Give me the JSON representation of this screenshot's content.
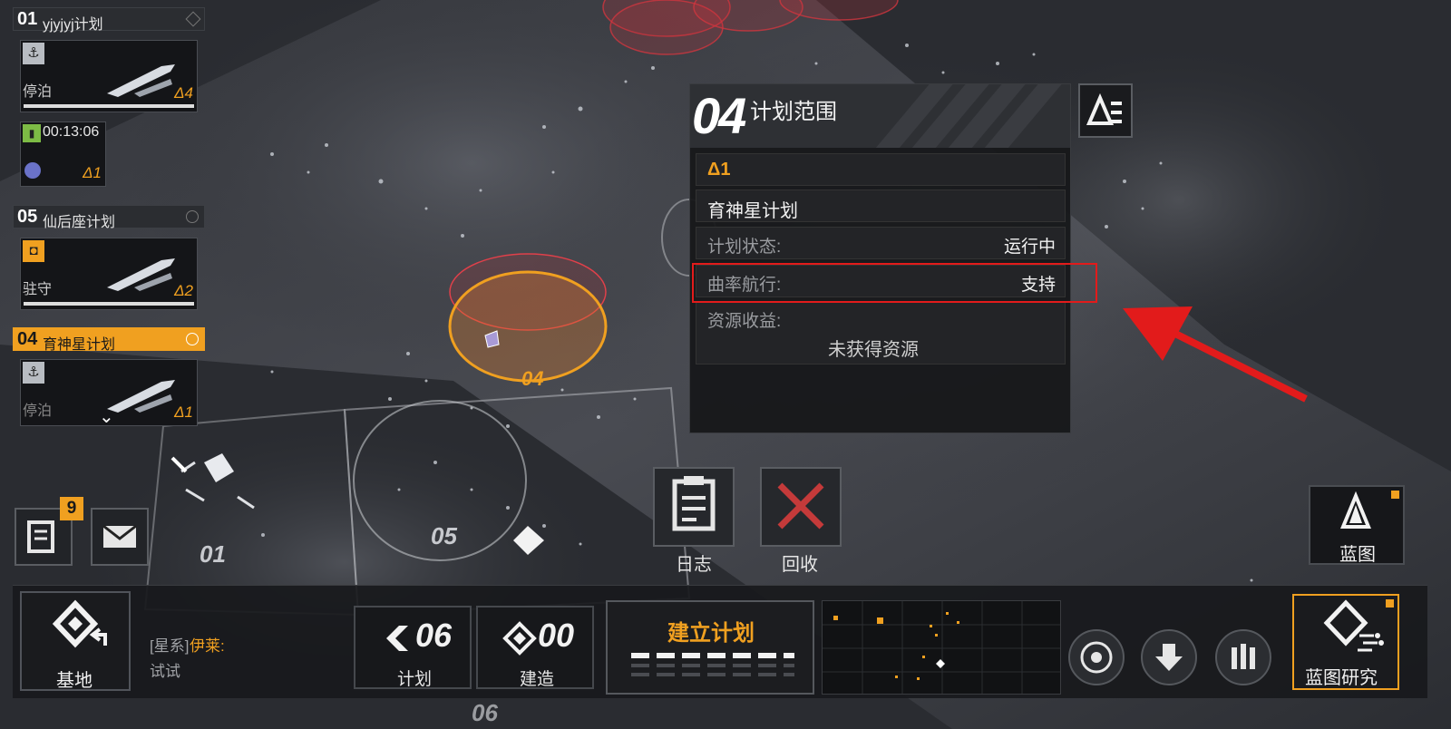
{
  "fleets": [
    {
      "num": "01",
      "name": "yjyjyj计划",
      "ships": [
        {
          "status": "停泊",
          "level": "Δ4",
          "icon": "anchor-icon"
        },
        {
          "timer": "00:13:06",
          "level": "Δ1",
          "icon": "cargo-icon"
        }
      ]
    },
    {
      "num": "05",
      "name": "仙后座计划",
      "ships": [
        {
          "status": "驻守",
          "level": "Δ2",
          "icon": "shield-icon"
        }
      ]
    },
    {
      "num": "04",
      "name": "育神星计划",
      "active": true,
      "ships": [
        {
          "status": "停泊",
          "level": "Δ1",
          "icon": "anchor-icon"
        }
      ]
    }
  ],
  "map": {
    "zone_labels": [
      "04",
      "01",
      "05",
      "06"
    ]
  },
  "panel": {
    "num": "04",
    "title": "计划范围",
    "level": "Δ1",
    "plan_name": "育神星计划",
    "rows": [
      {
        "label": "计划状态:",
        "value": "运行中"
      },
      {
        "label": "曲率航行:",
        "value": "支持"
      },
      {
        "label": "资源收益:",
        "value": ""
      }
    ],
    "resource_note": "未获得资源"
  },
  "actions": {
    "log_label": "日志",
    "recall_label": "回收"
  },
  "left_buttons": {
    "tasks_badge": "9"
  },
  "right_buttons": {
    "blueprint_label": "蓝图",
    "blueprint_research_label": "蓝图研究"
  },
  "bottom": {
    "base_label": "基地",
    "chat_channel": "[星系]",
    "chat_user": "伊莱:",
    "chat_message": "试试",
    "plan_count": "06",
    "plan_label": "计划",
    "build_count": "00",
    "build_label": "建造",
    "create_plan_label": "建立计划"
  },
  "colors": {
    "accent": "#f0a020",
    "highlight_red": "#e21b1b",
    "panel_bg": "#16171a"
  }
}
